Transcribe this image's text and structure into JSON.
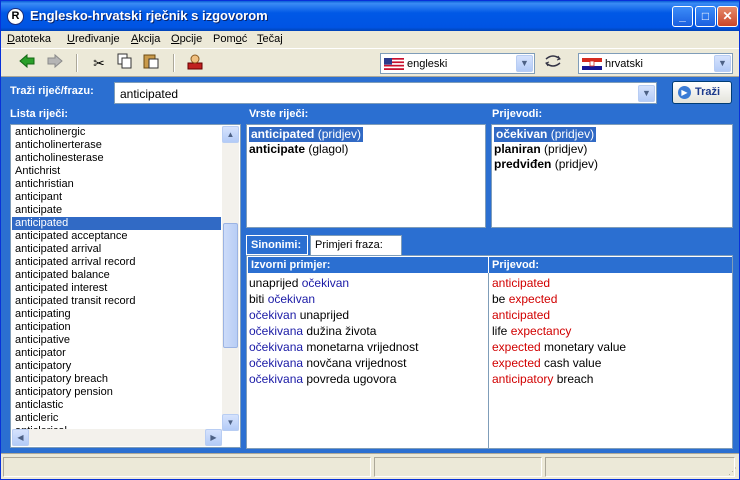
{
  "window": {
    "title": "Englesko-hrvatski rječnik s izgovorom",
    "icon_letter": "R"
  },
  "menu": [
    {
      "pre": "",
      "u": "D",
      "post": "atoteka"
    },
    {
      "pre": "",
      "u": "U",
      "post": "ređivanje"
    },
    {
      "pre": "",
      "u": "A",
      "post": "kcija"
    },
    {
      "pre": "",
      "u": "O",
      "post": "pcije"
    },
    {
      "pre": "Pom",
      "u": "o",
      "post": "ć"
    },
    {
      "pre": "",
      "u": "T",
      "post": "ečaj"
    }
  ],
  "toolbar": {
    "source_language": "engleski",
    "target_language": "hrvatski",
    "icons": [
      "back-arrow-icon",
      "forward-arrow-icon",
      "cut-icon",
      "copy-icon",
      "paste-icon",
      "user-install-icon",
      "swap-languages-icon"
    ]
  },
  "search": {
    "label": "Traži riječ/frazu:",
    "value": "anticipated",
    "button_label": "Traži"
  },
  "word_list": {
    "header": "Lista riječi:",
    "items": [
      "anticholinergic",
      "anticholinerterase",
      "anticholinesterase",
      "Antichrist",
      "antichristian",
      "anticipant",
      "anticipate",
      "anticipated",
      "anticipated acceptance",
      "anticipated arrival",
      "anticipated arrival record",
      "anticipated balance",
      "anticipated interest",
      "anticipated transit record",
      "anticipating",
      "anticipation",
      "anticipative",
      "anticipator",
      "anticipatory",
      "anticipatory breach",
      "anticipatory pension",
      "anticlastic",
      "anticleric",
      "anticlerical"
    ],
    "selected": "anticipated"
  },
  "word_types": {
    "header": "Vrste riječi:",
    "items": [
      {
        "word": "anticipated",
        "type": "(pridjev)",
        "selected": true
      },
      {
        "word": "anticipate",
        "type": "(glagol)",
        "selected": false
      }
    ]
  },
  "translations": {
    "header": "Prijevodi:",
    "items": [
      {
        "word": "očekivan",
        "type": "(pridjev)",
        "selected": true
      },
      {
        "word": "planiran",
        "type": "(pridjev)",
        "selected": false
      },
      {
        "word": "predviđen",
        "type": "(pridjev)",
        "selected": false
      }
    ]
  },
  "tabs": {
    "synonyms": "Sinonimi:",
    "examples": "Primjeri fraza:"
  },
  "examples": {
    "source_header": "Izvorni primjer:",
    "target_header": "Prijevod:",
    "source": [
      [
        {
          "t": "unaprijed ",
          "c": "black"
        },
        {
          "t": "očekivan",
          "c": "blue"
        }
      ],
      [
        {
          "t": "biti ",
          "c": "black"
        },
        {
          "t": "očekivan",
          "c": "blue"
        }
      ],
      [
        {
          "t": "očekivan",
          "c": "blue"
        },
        {
          "t": " unaprijed",
          "c": "black"
        }
      ],
      [
        {
          "t": "očekivana",
          "c": "blue"
        },
        {
          "t": " dužina života",
          "c": "black"
        }
      ],
      [
        {
          "t": "očekivana",
          "c": "blue"
        },
        {
          "t": " monetarna vrijednost",
          "c": "black"
        }
      ],
      [
        {
          "t": "očekivana",
          "c": "blue"
        },
        {
          "t": " novčana vrijednost",
          "c": "black"
        }
      ],
      [
        {
          "t": "očekivana",
          "c": "blue"
        },
        {
          "t": " povreda ugovora",
          "c": "black"
        }
      ]
    ],
    "target": [
      [
        {
          "t": "anticipated",
          "c": "red"
        }
      ],
      [
        {
          "t": "be ",
          "c": "black"
        },
        {
          "t": "expected",
          "c": "red"
        }
      ],
      [
        {
          "t": "anticipated",
          "c": "red"
        }
      ],
      [
        {
          "t": "life ",
          "c": "black"
        },
        {
          "t": "expectancy",
          "c": "red"
        }
      ],
      [
        {
          "t": "expected",
          "c": "red"
        },
        {
          "t": " monetary value",
          "c": "black"
        }
      ],
      [
        {
          "t": "expected",
          "c": "red"
        },
        {
          "t": " cash value",
          "c": "black"
        }
      ],
      [
        {
          "t": "anticipatory",
          "c": "red"
        },
        {
          "t": " breach",
          "c": "black"
        }
      ]
    ]
  },
  "colors": {
    "header_bg": "#2b6fd1",
    "selection": "#316ac5",
    "source_highlight": "#1a1aa6",
    "target_highlight": "#d10000"
  }
}
